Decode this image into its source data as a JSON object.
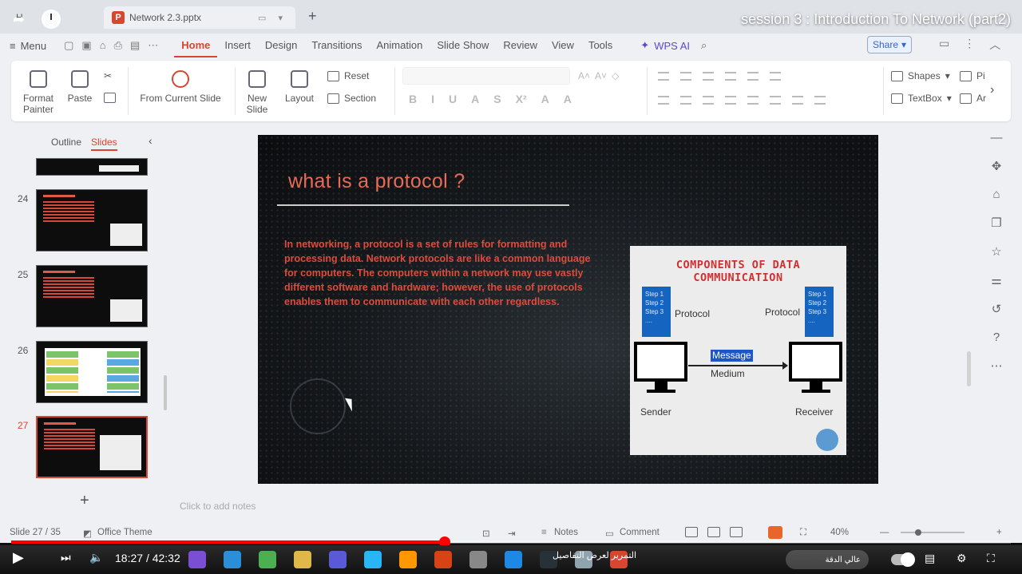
{
  "youtube": {
    "video_title": "session 3 : Introduction To Network (part2)",
    "time_current": "18:27",
    "time_total": "42:32",
    "time_separator": "/",
    "progress_fraction": 0.434,
    "chapter_text": "التمرير لعرض التفاصيل",
    "speed_label": "عالي الدقة",
    "colors": {
      "progress": "#ff0000"
    }
  },
  "tabs": {
    "home_label": "H",
    "doc_label": "Network 2.3.pptx",
    "doc_badge": "P"
  },
  "menu": {
    "menu_label": "Menu",
    "ribbon_tabs": [
      "Home",
      "Insert",
      "Design",
      "Transitions",
      "Animation",
      "Slide Show",
      "Review",
      "View",
      "Tools"
    ],
    "active_tab": "Home",
    "wps_ai": "WPS AI",
    "share": "Share"
  },
  "ribbon": {
    "format_painter": "Format Painter",
    "paste": "Paste",
    "from_current_slide": "From Current Slide",
    "new_slide": "New Slide",
    "layout": "Layout",
    "reset": "Reset",
    "section": "Section",
    "shapes": "Shapes",
    "textbox": "TextBox",
    "pic_trunc": "Pi",
    "ar_trunc": "Ar"
  },
  "slides_pane": {
    "outline_label": "Outline",
    "slides_label": "Slides",
    "slide_numbers": [
      "24",
      "25",
      "26",
      "27"
    ],
    "selected": "27"
  },
  "slide": {
    "title": "what is a protocol ?",
    "body": "In networking, a protocol is a set of rules for formatting and processing data. Network protocols are like a common language for computers. The computers within a network may use vastly different software and hardware; however, the use of protocols enables them to communicate with each other regardless.",
    "card": {
      "title": "COMPONENTS OF DATA COMMUNICATION",
      "steps_left": [
        "Step 1",
        "Step 2",
        "Step 3",
        "...."
      ],
      "steps_right": [
        "Step 1",
        "Step 2",
        "Step 3",
        "...."
      ],
      "protocol_left": "Protocol",
      "protocol_right": "Protocol",
      "message": "Message",
      "medium": "Medium",
      "sender": "Sender",
      "receiver": "Receiver"
    }
  },
  "notes_placeholder": "Click to add notes",
  "status": {
    "slide_counter": "Slide 27 / 35",
    "theme": "Office Theme",
    "notes": "Notes",
    "comment": "Comment",
    "zoom": "40%"
  }
}
